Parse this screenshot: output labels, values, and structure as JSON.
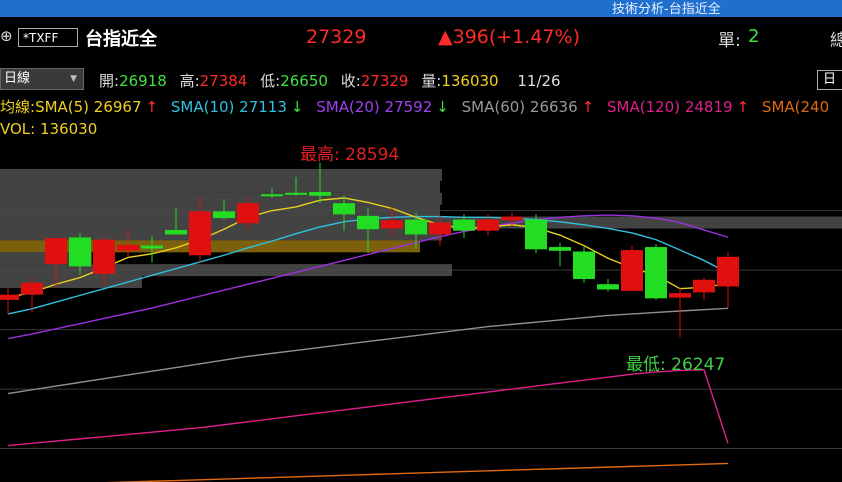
{
  "titlebar": {
    "title": "技術分析-台指近全"
  },
  "header": {
    "add_icon": "⊕",
    "symbol": "*TXFF",
    "name": "台指近全",
    "price": "27329",
    "change": "▲396(+1.47%)",
    "unit_label": "單:",
    "unit_value": "2",
    "right_cut": "總"
  },
  "quote": {
    "period": "日線",
    "open_label": "開:",
    "open": "26918",
    "high_label": "高:",
    "high": "27384",
    "low_label": "低:",
    "low": "26650",
    "close_label": "收:",
    "close": "27329",
    "vol_label": "量:",
    "vol": "136030",
    "date": "11/26",
    "right_button": "日"
  },
  "indicators": {
    "prefix": "均線:",
    "sma5": "SMA(5) 26967",
    "sma5_arrow": "↑",
    "sma10": "SMA(10) 27113",
    "sma10_arrow": "↓",
    "sma20": "SMA(20) 27592",
    "sma20_arrow": "↓",
    "sma60": "SMA(60) 26636",
    "sma60_arrow": "↑",
    "sma120": "SMA(120) 24819",
    "sma120_arrow": "↑",
    "sma240": "SMA(240"
  },
  "volume": {
    "label": "VOL: 136030"
  },
  "chart_data": {
    "type": "candlestick",
    "high_marker": "最高: 28594",
    "low_marker": "最低: 26247",
    "colors": {
      "up": "#e01010",
      "down": "#22dd22",
      "sma5": "#e8d020",
      "sma10": "#30c0e0",
      "sma20": "#9b30e0",
      "sma60": "#909090",
      "sma120": "#e0208a",
      "sma240": "#e06a10",
      "high_text": "#e02020",
      "low_text": "#40d040"
    },
    "ylim": [
      24300,
      28900
    ],
    "candles": [
      {
        "o": 26750,
        "h": 26920,
        "l": 26560,
        "c": 26820
      },
      {
        "o": 26820,
        "h": 27050,
        "l": 26580,
        "c": 26980
      },
      {
        "o": 27230,
        "h": 27550,
        "l": 26920,
        "c": 27580
      },
      {
        "o": 27590,
        "h": 27650,
        "l": 27090,
        "c": 27200
      },
      {
        "o": 27100,
        "h": 27600,
        "l": 26950,
        "c": 27560
      },
      {
        "o": 27410,
        "h": 27700,
        "l": 27340,
        "c": 27490
      },
      {
        "o": 27480,
        "h": 27600,
        "l": 27250,
        "c": 27440
      },
      {
        "o": 27690,
        "h": 27990,
        "l": 27650,
        "c": 27630
      },
      {
        "o": 27350,
        "h": 28150,
        "l": 27250,
        "c": 27940
      },
      {
        "o": 27940,
        "h": 28100,
        "l": 27830,
        "c": 27850
      },
      {
        "o": 27780,
        "h": 28150,
        "l": 27700,
        "c": 28050
      },
      {
        "o": 28170,
        "h": 28250,
        "l": 28120,
        "c": 28150
      },
      {
        "o": 28190,
        "h": 28400,
        "l": 28150,
        "c": 28170
      },
      {
        "o": 28200,
        "h": 28594,
        "l": 28050,
        "c": 28150
      },
      {
        "o": 28050,
        "h": 28150,
        "l": 27680,
        "c": 27900
      },
      {
        "o": 27880,
        "h": 27980,
        "l": 27380,
        "c": 27700
      },
      {
        "o": 27710,
        "h": 28000,
        "l": 27600,
        "c": 27820
      },
      {
        "o": 27830,
        "h": 27920,
        "l": 27430,
        "c": 27630
      },
      {
        "o": 27630,
        "h": 27880,
        "l": 27480,
        "c": 27790
      },
      {
        "o": 27830,
        "h": 27900,
        "l": 27580,
        "c": 27680
      },
      {
        "o": 27680,
        "h": 27900,
        "l": 27620,
        "c": 27830
      },
      {
        "o": 27820,
        "h": 27920,
        "l": 27740,
        "c": 27870
      },
      {
        "o": 27830,
        "h": 27900,
        "l": 27380,
        "c": 27430
      },
      {
        "o": 27460,
        "h": 27520,
        "l": 27200,
        "c": 27410
      },
      {
        "o": 27400,
        "h": 27460,
        "l": 26980,
        "c": 27030
      },
      {
        "o": 26960,
        "h": 27030,
        "l": 26860,
        "c": 26890
      },
      {
        "o": 26870,
        "h": 27480,
        "l": 26860,
        "c": 27420
      },
      {
        "o": 27460,
        "h": 27500,
        "l": 26750,
        "c": 26770
      },
      {
        "o": 26780,
        "h": 26920,
        "l": 26247,
        "c": 26840
      },
      {
        "o": 26850,
        "h": 27050,
        "l": 26750,
        "c": 27020
      },
      {
        "o": 26930,
        "h": 27384,
        "l": 26650,
        "c": 27329
      }
    ],
    "sma5": [
      26780,
      26850,
      26960,
      27050,
      27180,
      27320,
      27370,
      27450,
      27560,
      27700,
      27860,
      27950,
      28000,
      28090,
      28120,
      28060,
      27980,
      27860,
      27760,
      27710,
      27730,
      27760,
      27720,
      27620,
      27480,
      27310,
      27180,
      27080,
      26900,
      26920,
      26967
    ],
    "sma10": [
      26560,
      26630,
      26720,
      26810,
      26900,
      26990,
      27080,
      27170,
      27260,
      27350,
      27450,
      27540,
      27640,
      27730,
      27800,
      27840,
      27860,
      27870,
      27870,
      27860,
      27860,
      27850,
      27830,
      27800,
      27760,
      27710,
      27650,
      27560,
      27420,
      27280,
      27113
    ],
    "sma20": [
      26230,
      26290,
      26360,
      26430,
      26500,
      26570,
      26640,
      26720,
      26800,
      26880,
      26960,
      27040,
      27120,
      27200,
      27280,
      27360,
      27440,
      27520,
      27600,
      27670,
      27730,
      27780,
      27830,
      27860,
      27880,
      27890,
      27880,
      27850,
      27790,
      27690,
      27592
    ],
    "sma60": [
      25490,
      25540,
      25590,
      25640,
      25690,
      25740,
      25790,
      25840,
      25890,
      25940,
      25990,
      26030,
      26070,
      26110,
      26150,
      26190,
      26230,
      26270,
      26310,
      26350,
      26390,
      26420,
      26450,
      26480,
      26510,
      26540,
      26560,
      26580,
      26600,
      26618,
      26636
    ],
    "sma120": [
      24790,
      24820,
      24850,
      24880,
      24910,
      24940,
      24970,
      25000,
      25030,
      25070,
      25110,
      25150,
      25190,
      25230,
      25270,
      25310,
      25350,
      25390,
      25430,
      25470,
      25510,
      25550,
      25590,
      25630,
      25670,
      25710,
      25750,
      25780,
      25800,
      25810,
      24819
    ],
    "sma240": [
      24250,
      24260,
      24270,
      24280,
      24290,
      24300,
      24310,
      24320,
      24330,
      24340,
      24350,
      24360,
      24370,
      24380,
      24390,
      24400,
      24410,
      24420,
      24430,
      24440,
      24450,
      24460,
      24470,
      24480,
      24490,
      24500,
      24510,
      24520,
      24530,
      24540,
      24550
    ],
    "volume_profile": [
      {
        "price": 28430,
        "len": 442
      },
      {
        "price": 28270,
        "len": 440
      },
      {
        "price": 28110,
        "len": 442
      },
      {
        "price": 27950,
        "len": 440
      },
      {
        "price": 27790,
        "len": 842
      },
      {
        "price": 27630,
        "len": 442
      },
      {
        "price": 27470,
        "len": 420,
        "highlight": true
      },
      {
        "price": 27310,
        "len": 92
      },
      {
        "price": 27150,
        "len": 452
      },
      {
        "price": 26990,
        "len": 142
      }
    ],
    "gridlines": [
      27950,
      27150,
      26350,
      25550,
      24750
    ]
  }
}
